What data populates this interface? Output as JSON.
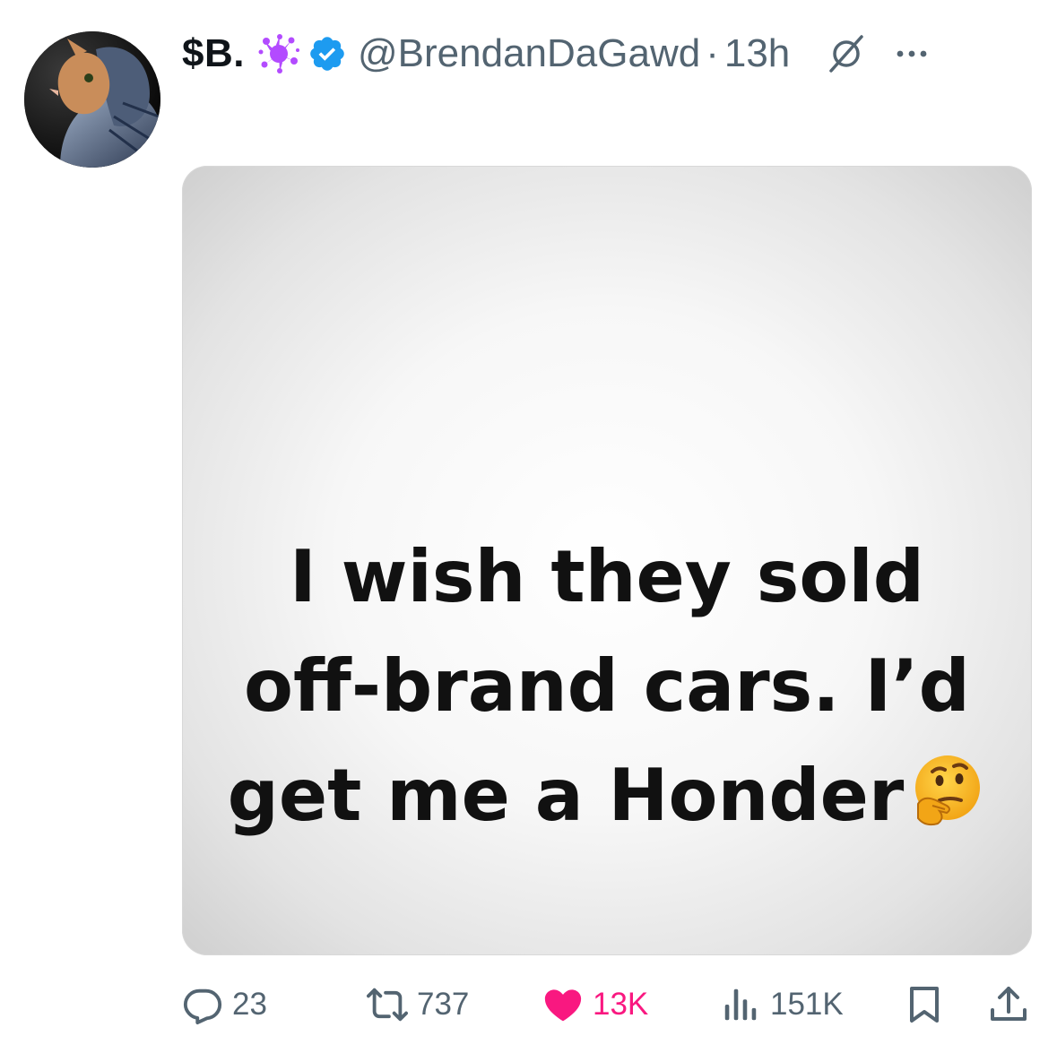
{
  "tweet": {
    "display_name": "$B.",
    "handle": "@BrendanDaGawd",
    "separator": "·",
    "time": "13h",
    "media_text": {
      "line1": "I wish they sold",
      "line2": "off-brand cars. I’d",
      "line3": "get me a Honder"
    }
  },
  "icons": {
    "avatar": "cat-in-puffer-jacket-avatar",
    "badge_1": "purple-splat-icon",
    "badge_2": "verified-badge-icon",
    "grok": "grok-icon",
    "more": "more-icon",
    "emoji": "thinking-face-emoji"
  },
  "actions": {
    "replies": "23",
    "reposts": "737",
    "likes": "13K",
    "views": "151K"
  },
  "colors": {
    "verified_blue": "#1d9bf0",
    "like_pink": "#f91880",
    "secondary_text": "#536471",
    "splat_purple": "#b34bff"
  }
}
